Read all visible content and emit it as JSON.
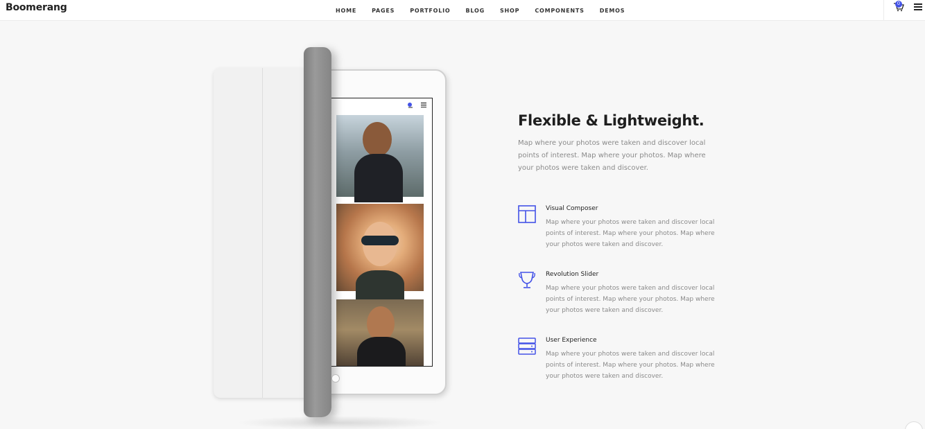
{
  "header": {
    "brand": "Boomerang",
    "nav": [
      "HOME",
      "PAGES",
      "PORTFOLIO",
      "BLOG",
      "SHOP",
      "COMPONENTS",
      "DEMOS"
    ],
    "cart_count": "0"
  },
  "hero": {
    "title": "Flexible & Lightweight.",
    "intro": "Map where your photos were taken and discover local points of interest. Map where your photos. Map where your photos were taken and discover."
  },
  "features": [
    {
      "icon": "layout-icon",
      "title": "Visual Composer",
      "description": "Map where your photos were taken and discover local points of interest. Map where your photos. Map where your photos were taken and discover."
    },
    {
      "icon": "trophy-icon",
      "title": "Revolution Slider",
      "description": "Map where your photos were taken and discover local points of interest. Map where your photos. Map where your photos were taken and discover."
    },
    {
      "icon": "server-icon",
      "title": "User Experience",
      "description": "Map where your photos were taken and discover local points of interest. Map where your photos. Map where your photos were taken and discover."
    }
  ],
  "colors": {
    "accent": "#4352e7",
    "text": "#1e1e1e",
    "muted": "#8a8a8a",
    "background": "#f7f7f7"
  }
}
